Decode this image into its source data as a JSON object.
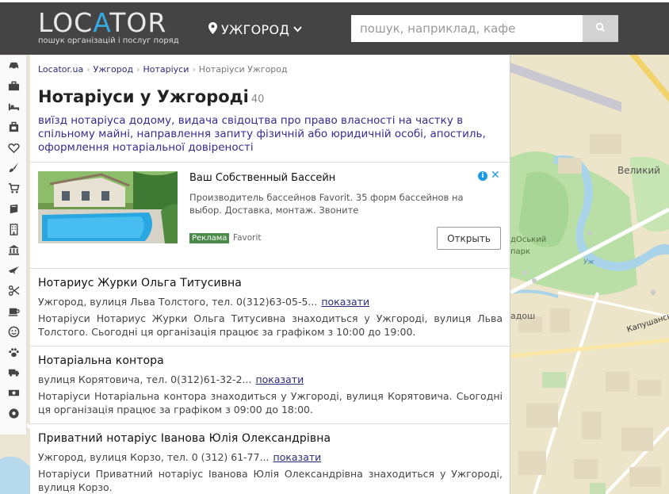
{
  "header": {
    "logo_text_pre": "LOC",
    "logo_text_accent": "A",
    "logo_text_post": "TOR",
    "logo_tagline": "пошук організацій і послуг поряд",
    "city": "УЖГОРОД",
    "search_placeholder": "пошук, наприклад, кафе",
    "accent_color": "#36a9e1"
  },
  "breadcrumbs": [
    {
      "label": "Locator.ua"
    },
    {
      "label": "Ужгород"
    },
    {
      "label": "Нотаріуси"
    },
    {
      "label": "Нотаріуси Ужгород"
    }
  ],
  "page": {
    "title": "Нотаріуси у Ужгороді",
    "count": "40",
    "subtitle": "виїзд нотаріуса додому, видача свідоцтва про право власності на частку в спільному майні, направлення запиту фізичній або юридичній особі, апостиль, оформлення нотаріальної довіреності"
  },
  "ad": {
    "title": "Ваш Собственный Бассейн",
    "description": "Производитель бассейнов Favorit. 35 форм бассейнов на выбор. Доставка, монтаж. Звоните",
    "badge": "Реклама",
    "brand": "Favorit",
    "button": "Открыть",
    "info_glyph": "i",
    "close_glyph": "✕"
  },
  "listings": [
    {
      "name": "Нотариус Журки Ольга Титусивна",
      "address": "Ужгород, вулиця Льва Толстого, тел. 0(312)63-05-5...",
      "show_label": "показати",
      "description": "Нотаріуси Нотариус Журки Ольга Титусивна знаходиться у Ужгороді, вулиця Льва Толстого. Сьогодні ця організація працює за графіком з 10:00 до 19:00."
    },
    {
      "name": "Нотаріальна контора",
      "address": "вулиця Корятовича, тел. 0(312)61-32-2...",
      "show_label": "показати",
      "description": "Нотаріуси Нотаріальна контора знаходиться у Ужгороді, вулиця Корятовича. Сьогодні ця організація працює за графіком з 09:00 до 18:00."
    },
    {
      "name": "Приватний нотаріус Іванова Юлія Олександрівна",
      "address": "Ужгород, вулиця Корзо, тел. 0 (312) 61-77...",
      "show_label": "показати",
      "description": "Нотаріуси Приватний нотаріус Іванова Юлія Олександрівна знаходиться у Ужгороді, вулиця Корзо."
    }
  ],
  "sidebar_icons": [
    "car-icon",
    "briefcase-icon",
    "bed-icon",
    "suitcase-icon",
    "heart-icon",
    "brush-icon",
    "cart-icon",
    "books-icon",
    "building-icon",
    "bank-icon",
    "plane-icon",
    "scissors-icon",
    "coffee-icon",
    "smile-icon",
    "paw-icon",
    "truck-icon",
    "money-icon",
    "soccer-ball-icon"
  ],
  "map": {
    "labels": [
      "Великий",
      "дOський",
      "парк",
      "Уж",
      "Капушансь",
      "адош"
    ]
  }
}
